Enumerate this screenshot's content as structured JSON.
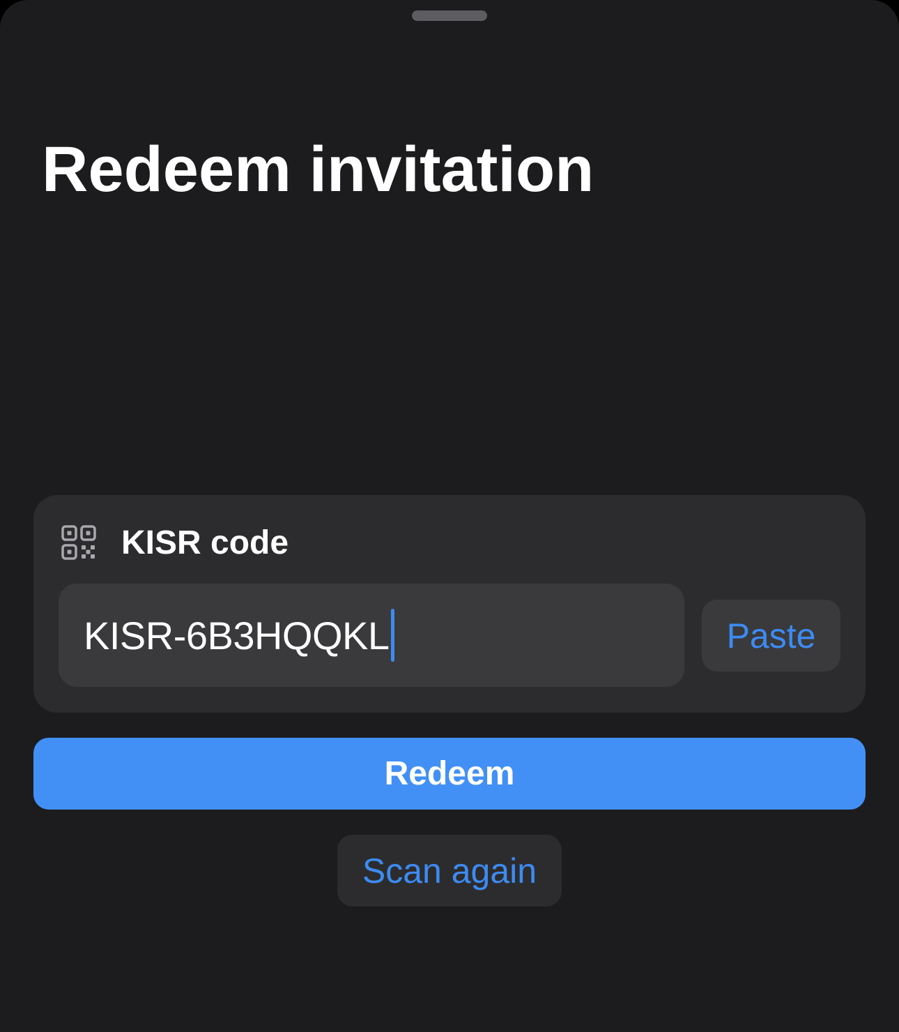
{
  "sheet": {
    "title": "Redeem invitation"
  },
  "code_card": {
    "icon": "qrcode-icon",
    "label": "KISR code",
    "input_value": "KISR-6B3HQQKL",
    "paste_label": "Paste"
  },
  "actions": {
    "redeem_label": "Redeem",
    "scan_again_label": "Scan again"
  },
  "colors": {
    "background": "#1c1c1e",
    "card": "#2c2c2e",
    "field": "#3a3a3c",
    "accent": "#4290f6",
    "link": "#3d8bf2",
    "text": "#ffffff"
  }
}
